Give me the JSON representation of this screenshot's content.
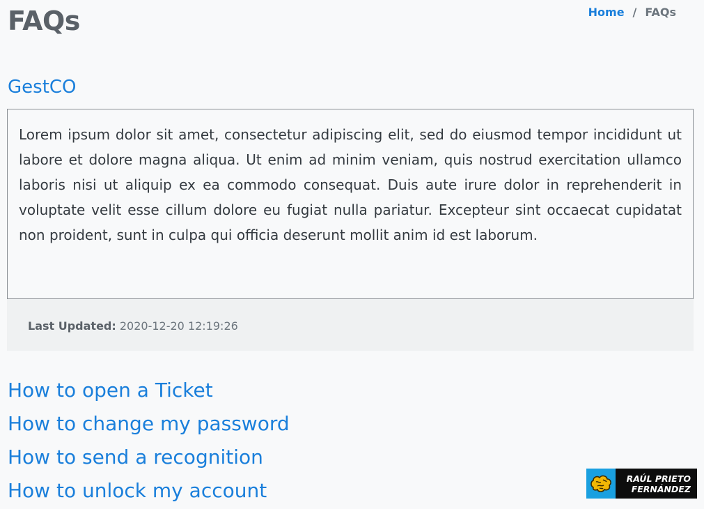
{
  "header": {
    "title": "FAQs",
    "breadcrumb": {
      "home": "Home",
      "separator": "/",
      "current": "FAQs"
    }
  },
  "faq": {
    "category": "GestCO",
    "body": "Lorem ipsum dolor sit amet, consectetur adipiscing elit, sed do eiusmod tempor incididunt ut labore et dolore magna aliqua. Ut enim ad minim veniam, quis nostrud exercitation ullamco laboris nisi ut aliquip ex ea commodo consequat. Duis aute irure dolor in reprehenderit in voluptate velit esse cillum dolore eu fugiat nulla pariatur. Excepteur sint occaecat cupidatat non proident, sunt in culpa qui officia deserunt mollit anim id est laborum.",
    "last_updated_label": "Last Updated:",
    "last_updated_value": "2020-12-20 12:19:26"
  },
  "links": [
    "How to open a Ticket",
    "How to change my password",
    "How to send a recognition",
    "How to unlock my account"
  ],
  "watermark": {
    "line1": "RAÚL PRIETO",
    "line2": "FERNÁNDEZ"
  },
  "colors": {
    "accent": "#1a7fdb",
    "background": "#f8f9fa",
    "footer_bg": "#eff1f2",
    "watermark_logo": "#1aa0e0"
  }
}
